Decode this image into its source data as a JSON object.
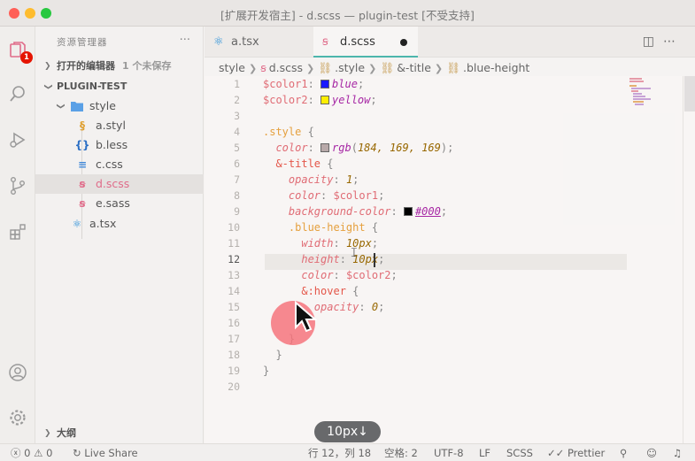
{
  "window": {
    "title": "[扩展开发宿主] - d.scss — plugin-test [不受支持]"
  },
  "activity": {
    "scm_badge": "1"
  },
  "sidebar": {
    "header": "资源管理器",
    "more": "···",
    "open_editors": {
      "label": "打开的编辑器",
      "sub": "1 个未保存"
    },
    "project": "PLUGIN-TEST",
    "folder": "style",
    "files": [
      {
        "name": "a.styl",
        "icon": "stylus-icon",
        "glyph": "§",
        "color": "#e0a030"
      },
      {
        "name": "b.less",
        "icon": "less-icon",
        "glyph": "{}",
        "color": "#2b6fc4"
      },
      {
        "name": "c.css",
        "icon": "css-icon",
        "glyph": "≡",
        "color": "#3f88d8"
      },
      {
        "name": "d.scss",
        "icon": "sass-icon",
        "glyph": "ꞩ",
        "color": "#e06c8a"
      },
      {
        "name": "e.sass",
        "icon": "sass-icon",
        "glyph": "ꞩ",
        "color": "#e06c8a"
      }
    ],
    "root_file": {
      "name": "a.tsx",
      "icon": "react-icon",
      "glyph": "⚛",
      "color": "#2a90d8"
    },
    "outline": "大纲"
  },
  "tabs": [
    {
      "label": "a.tsx",
      "glyph": "⚛",
      "color": "#2a90d8"
    },
    {
      "label": "d.scss",
      "glyph": "ꞩ",
      "color": "#e06c8a"
    }
  ],
  "breadcrumb": [
    "style",
    "d.scss",
    ".style",
    "&-title",
    ".blue-height"
  ],
  "editor": {
    "line_numbers": [
      "1",
      "2",
      "3",
      "4",
      "5",
      "6",
      "7",
      "8",
      "9",
      "10",
      "11",
      "12",
      "13",
      "14",
      "15",
      "16",
      "17",
      "18",
      "19",
      "20"
    ],
    "current_line": "12",
    "code": {
      "l1_var": "$color1",
      "l1_val": "blue",
      "l1_swatch": "#1a1aff",
      "l2_var": "$color2",
      "l2_val": "yellow",
      "l2_swatch": "#ffee00",
      "l4_sel": ".style",
      "l5_prop": "color",
      "l5_fn": "rgb",
      "l5_args": "184, 169, 169",
      "l5_swatch": "#b8a9a9",
      "l6_sel": "&-title",
      "l7_prop": "opacity",
      "l7_val": "1",
      "l8_prop": "color",
      "l8_val": "$color1",
      "l9_prop": "background-color",
      "l9_val": "#000",
      "l9_swatch": "#000000",
      "l10_sel": ".blue-height",
      "l11_prop": "width",
      "l11_val": "10px",
      "l12_prop": "height",
      "l12_val": "10px",
      "l13_prop": "color",
      "l13_val": "$color2",
      "l14_sel": "&:hover",
      "l15_prop": "opacity",
      "l15_val": "0"
    }
  },
  "toast": "10px↓",
  "status": {
    "errors": "0",
    "warnings": "0",
    "live_share": "Live Share",
    "position": "行 12，列 18",
    "indent": "空格: 2",
    "encoding": "UTF-8",
    "eol": "LF",
    "language": "SCSS",
    "prettier": "Prettier"
  }
}
